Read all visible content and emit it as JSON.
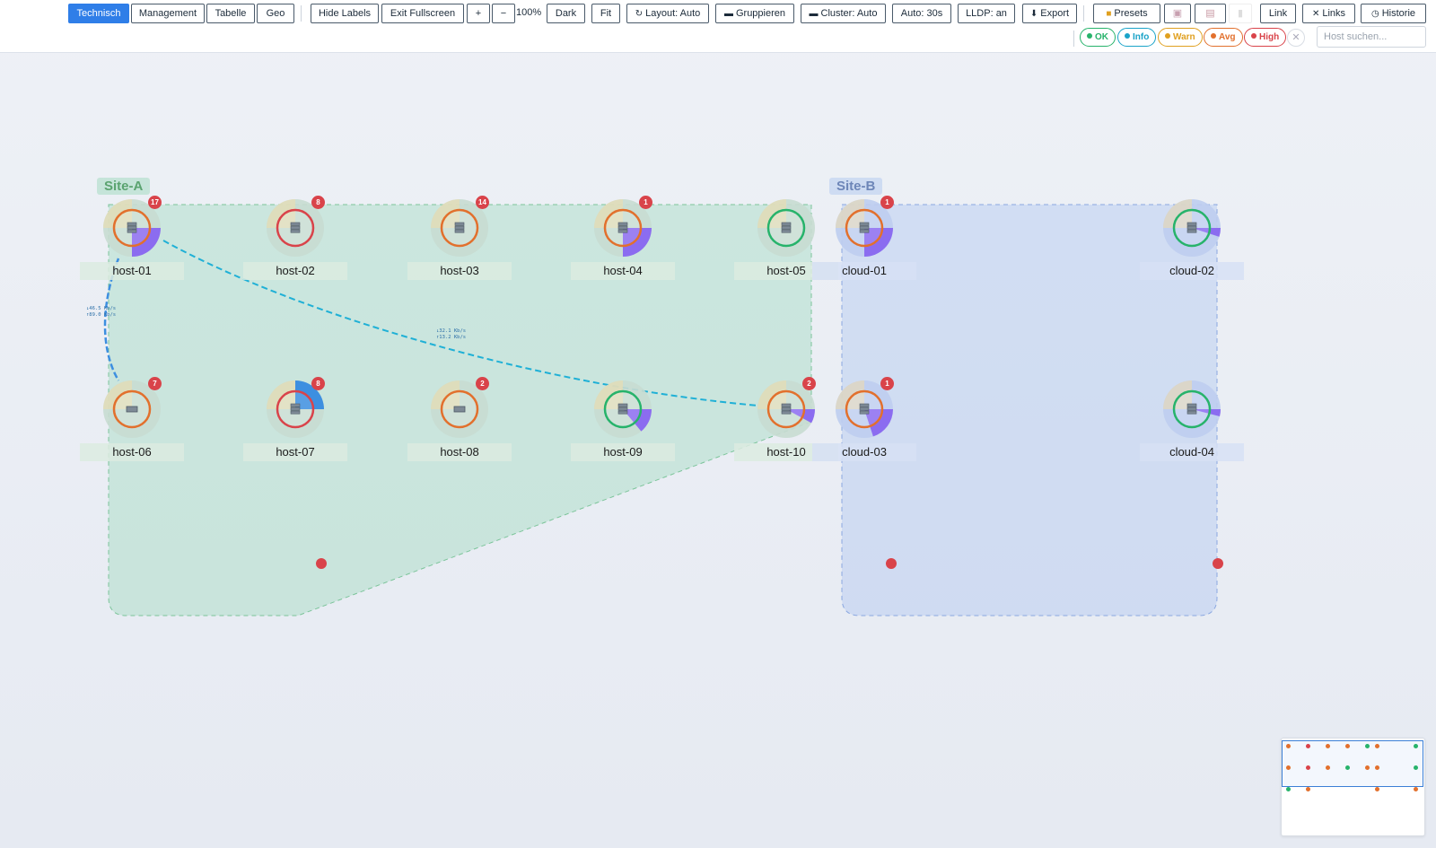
{
  "toolbar": {
    "view_tabs": [
      "Technisch",
      "Management",
      "Tabelle",
      "Geo"
    ],
    "hide_labels": "Hide Labels",
    "exit_fullscreen": "Exit Fullscreen",
    "zoom_in": "+",
    "zoom_out": "−",
    "zoom_level": "100%",
    "dark": "Dark",
    "fit": "Fit",
    "layout": "Layout: Auto",
    "group": "Gruppieren",
    "cluster": "Cluster: Auto",
    "auto_refresh": "Auto: 30s",
    "lldp": "LLDP: an",
    "export": "Export",
    "presets": "Presets",
    "link": "Link",
    "links": "Links",
    "history": "Historie"
  },
  "filters": {
    "ok": "OK",
    "info": "Info",
    "warn": "Warn",
    "avg": "Avg",
    "high": "High",
    "clear": "✕"
  },
  "search": {
    "placeholder": "Host suchen..."
  },
  "sites": [
    {
      "name": "Site-A",
      "color": "#5aa36f"
    },
    {
      "name": "Site-B",
      "color": "#6d86b8"
    }
  ],
  "hosts": [
    {
      "name": "host-01",
      "ring": "#e2702d",
      "badge": "17",
      "load": 0.25
    },
    {
      "name": "host-02",
      "ring": "#d9434a",
      "badge": "8",
      "load": 0
    },
    {
      "name": "host-03",
      "ring": "#e2702d",
      "badge": "14",
      "load": 0
    },
    {
      "name": "host-04",
      "ring": "#e2702d",
      "badge": "1",
      "load": 0.25
    },
    {
      "name": "host-05",
      "ring": "#27b36b",
      "badge": "",
      "load": 0
    },
    {
      "name": "cloud-01",
      "ring": "#e2702d",
      "badge": "1",
      "load": 0.25
    },
    {
      "name": "cloud-02",
      "ring": "#27b36b",
      "badge": "",
      "load": 0.05
    },
    {
      "name": "host-06",
      "ring": "#e2702d",
      "badge": "7",
      "load": 0
    },
    {
      "name": "host-07",
      "ring": "#d9434a",
      "badge": "8",
      "load": 0.25
    },
    {
      "name": "host-08",
      "ring": "#e2702d",
      "badge": "2",
      "load": 0
    },
    {
      "name": "host-09",
      "ring": "#27b36b",
      "badge": "",
      "load": 0.14
    },
    {
      "name": "host-10",
      "ring": "#e2702d",
      "badge": "2",
      "load": 0.08
    },
    {
      "name": "cloud-03",
      "ring": "#e2702d",
      "badge": "1",
      "load": 0.2
    },
    {
      "name": "cloud-04",
      "ring": "#27b36b",
      "badge": "",
      "load": 0.04
    }
  ],
  "links": [
    {
      "label_down": "↓46.5 Kb/s",
      "label_up": "↑89.0 Kb/s"
    },
    {
      "label_down": "↓32.1 Kb/s",
      "label_up": "↑13.2 Kb/s"
    }
  ],
  "colors": {
    "accent": "#2f7ee8",
    "ok": "#27b36b",
    "info": "#1aa3c8",
    "warn": "#e0a020",
    "avg": "#e2702d",
    "high": "#d9434a",
    "load": "#8b6cf0",
    "load_alt": "#3d8fe0",
    "link": "#1fb0d6"
  }
}
